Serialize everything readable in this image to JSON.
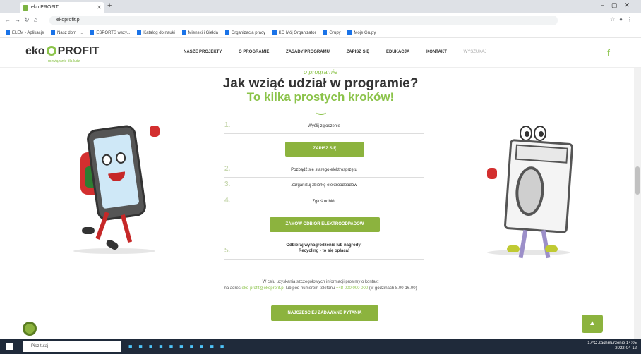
{
  "browser": {
    "tab_title": "eko PROFIT",
    "url": "ekoprofit.pl",
    "bookmarks": [
      "ELEM - Aplikacje",
      "Nasz dom i ...",
      "ESPORTS wszy...",
      "Katalog do nauki",
      "Mienski i Giełda",
      "Organizacja pracy",
      "KO Mój Organizator",
      "Grupy",
      "Moje Grupy"
    ]
  },
  "site": {
    "logo_text": "eko",
    "logo_text2": "PROFIT",
    "logo_sub": "rozwiązanie dla ludzi",
    "menu": [
      "NASZE PROJEKTY",
      "O PROGRAMIE",
      "ZASADY PROGRAMU",
      "ZAPISZ SIĘ",
      "EDUKACJA",
      "KONTAKT",
      "WYSZUKAJ"
    ],
    "fb": "f"
  },
  "main": {
    "pretitle": "o programie",
    "title": "Jak wziąć udział w programie?",
    "subtitle": "To kilka prostych kroków!",
    "steps": [
      {
        "num": "1.",
        "text": "Wyślij zgłoszenie"
      },
      {
        "num": "2.",
        "text": "Pozbądź się starego elektrosprzętu"
      },
      {
        "num": "3.",
        "text": "Zorganizuj zbiórkę elektroodpadów"
      },
      {
        "num": "4.",
        "text": "Zgłoś odbiór"
      },
      {
        "num": "5.",
        "text_line1": "Odbieraj wynagrodzenie lub nagrody!",
        "text_line2": "Recycling - to się opłaca!"
      }
    ],
    "btn_signup": "ZAPISZ SIĘ",
    "btn_order": "ZAMÓW ODBIÓR ELEKTROODPADÓW",
    "info_line1": "W celu uzyskania szczegółowych informacji prosimy o kontakt",
    "info_line2_a": "na adres ",
    "info_email": "eko-profit@ekoprofit.pl",
    "info_line2_b": " lub pod numerem telefonu ",
    "info_phone": "+48 000 000 000",
    "info_line2_c": " (w godzinach 8.00-16.00)",
    "btn_faq": "NAJCZĘŚCIEJ ZADAWANE PYTANIA"
  },
  "taskbar": {
    "search_placeholder": "Pisz tutaj",
    "tray_time": "14:05",
    "tray_date": "2022-04-12",
    "tray_weather": "17°C Zachmurzenie"
  },
  "colors": {
    "accent": "#8cb33e",
    "text": "#333333"
  }
}
